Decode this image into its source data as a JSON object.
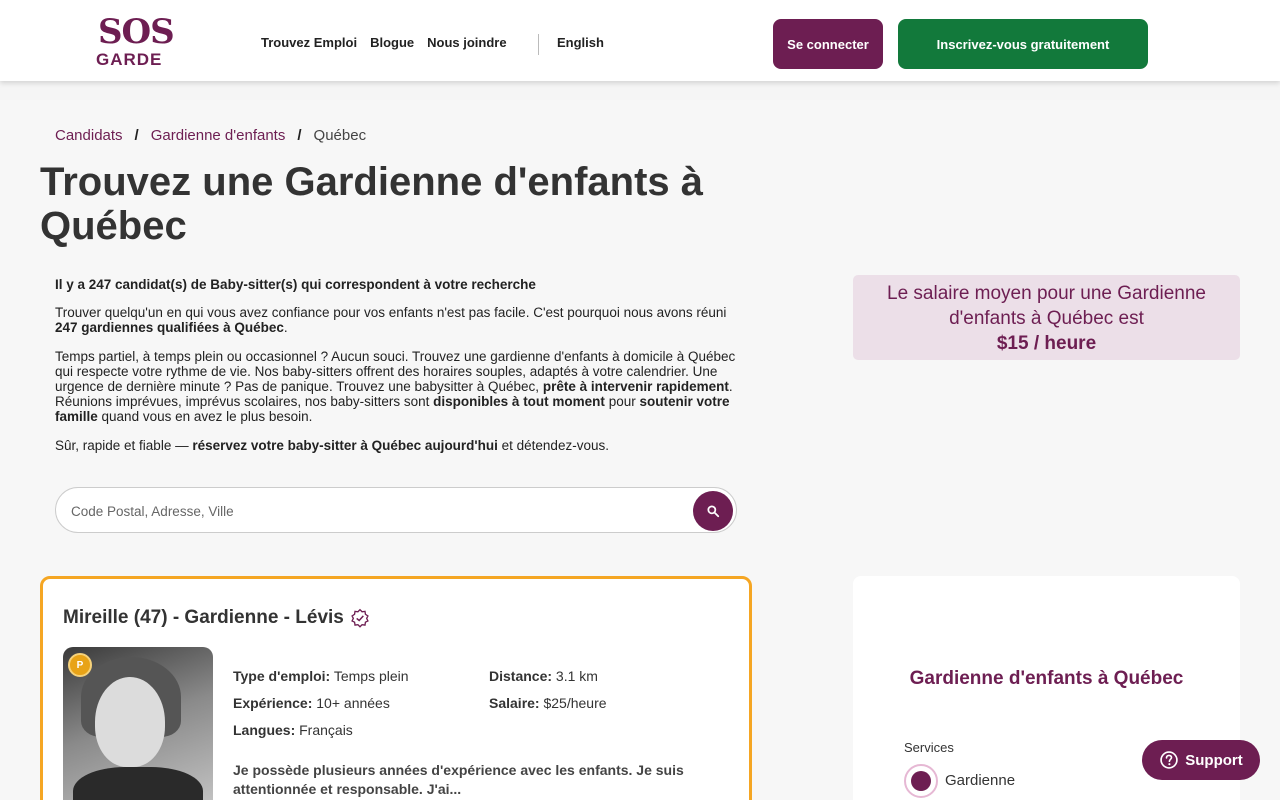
{
  "header": {
    "logo_top": "SOS",
    "logo_bottom": "GARDE",
    "nav": [
      "Trouvez Emploi",
      "Blogue",
      "Nous joindre"
    ],
    "language": "English",
    "login_label": "Se connecter",
    "signup_label": "Inscrivez-vous gratuitement"
  },
  "breadcrumb": {
    "items": [
      "Candidats",
      "Gardienne d'enfants",
      "Québec"
    ],
    "separator": "/"
  },
  "page_title": "Trouvez une Gardienne d'enfants à Québec",
  "intro": {
    "lead": "Il y a 247 candidat(s) de Baby-sitter(s) qui correspondent à votre recherche",
    "p1_a": "Trouver quelqu'un en qui vous avez confiance pour vos enfants n'est pas facile. C'est pourquoi nous avons réuni ",
    "p1_b": "247 gardiennes qualifiées à Québec",
    "p1_c": ".",
    "p2_a": "Temps partiel, à temps plein ou occasionnel ? Aucun souci. Trouvez une gardienne d'enfants à domicile à Québec qui respecte votre rythme de vie. Nos baby-sitters offrent des horaires souples, adaptés à votre calendrier. Une urgence de dernière minute ? Pas de panique. Trouvez une babysitter à Québec, ",
    "p2_b": "prête à intervenir rapidement",
    "p2_c": ". Réunions imprévues, imprévus scolaires, nos baby-sitters sont ",
    "p2_d": "disponibles à tout moment",
    "p2_e": " pour ",
    "p2_f": "soutenir votre famille",
    "p2_g": " quand vous en avez le plus besoin.",
    "p3_a": "Sûr, rapide et fiable — ",
    "p3_b": "réservez votre baby-sitter à Québec aujourd'hui",
    "p3_c": " et détendez-vous."
  },
  "search": {
    "placeholder": "Code Postal, Adresse, Ville",
    "value": ""
  },
  "salary": {
    "line1": "Le salaire moyen pour une Gardienne d'enfants à Québec est",
    "amount": "$15 / heure"
  },
  "candidate": {
    "title": "Mireille (47) - Gardienne - Lévis",
    "badge": "P",
    "job_type_label": "Type d'emploi:",
    "job_type": "Temps plein",
    "distance_label": "Distance:",
    "distance": "3.1 km",
    "experience_label": "Expérience:",
    "experience": "10+ années",
    "salary_label": "Salaire:",
    "salary": "$25/heure",
    "languages_label": "Langues:",
    "languages": "Français",
    "description": "Je possède plusieurs années d'expérience avec les enfants. Je suis attentionnée et responsable. J'ai..."
  },
  "side_panel": {
    "title": "Gardienne d'enfants à Québec",
    "services_label": "Services",
    "service_option": "Gardienne"
  },
  "support_label": "Support",
  "colors": {
    "brand": "#6d1e52",
    "signup": "#12793b",
    "card_border": "#f5a623"
  }
}
